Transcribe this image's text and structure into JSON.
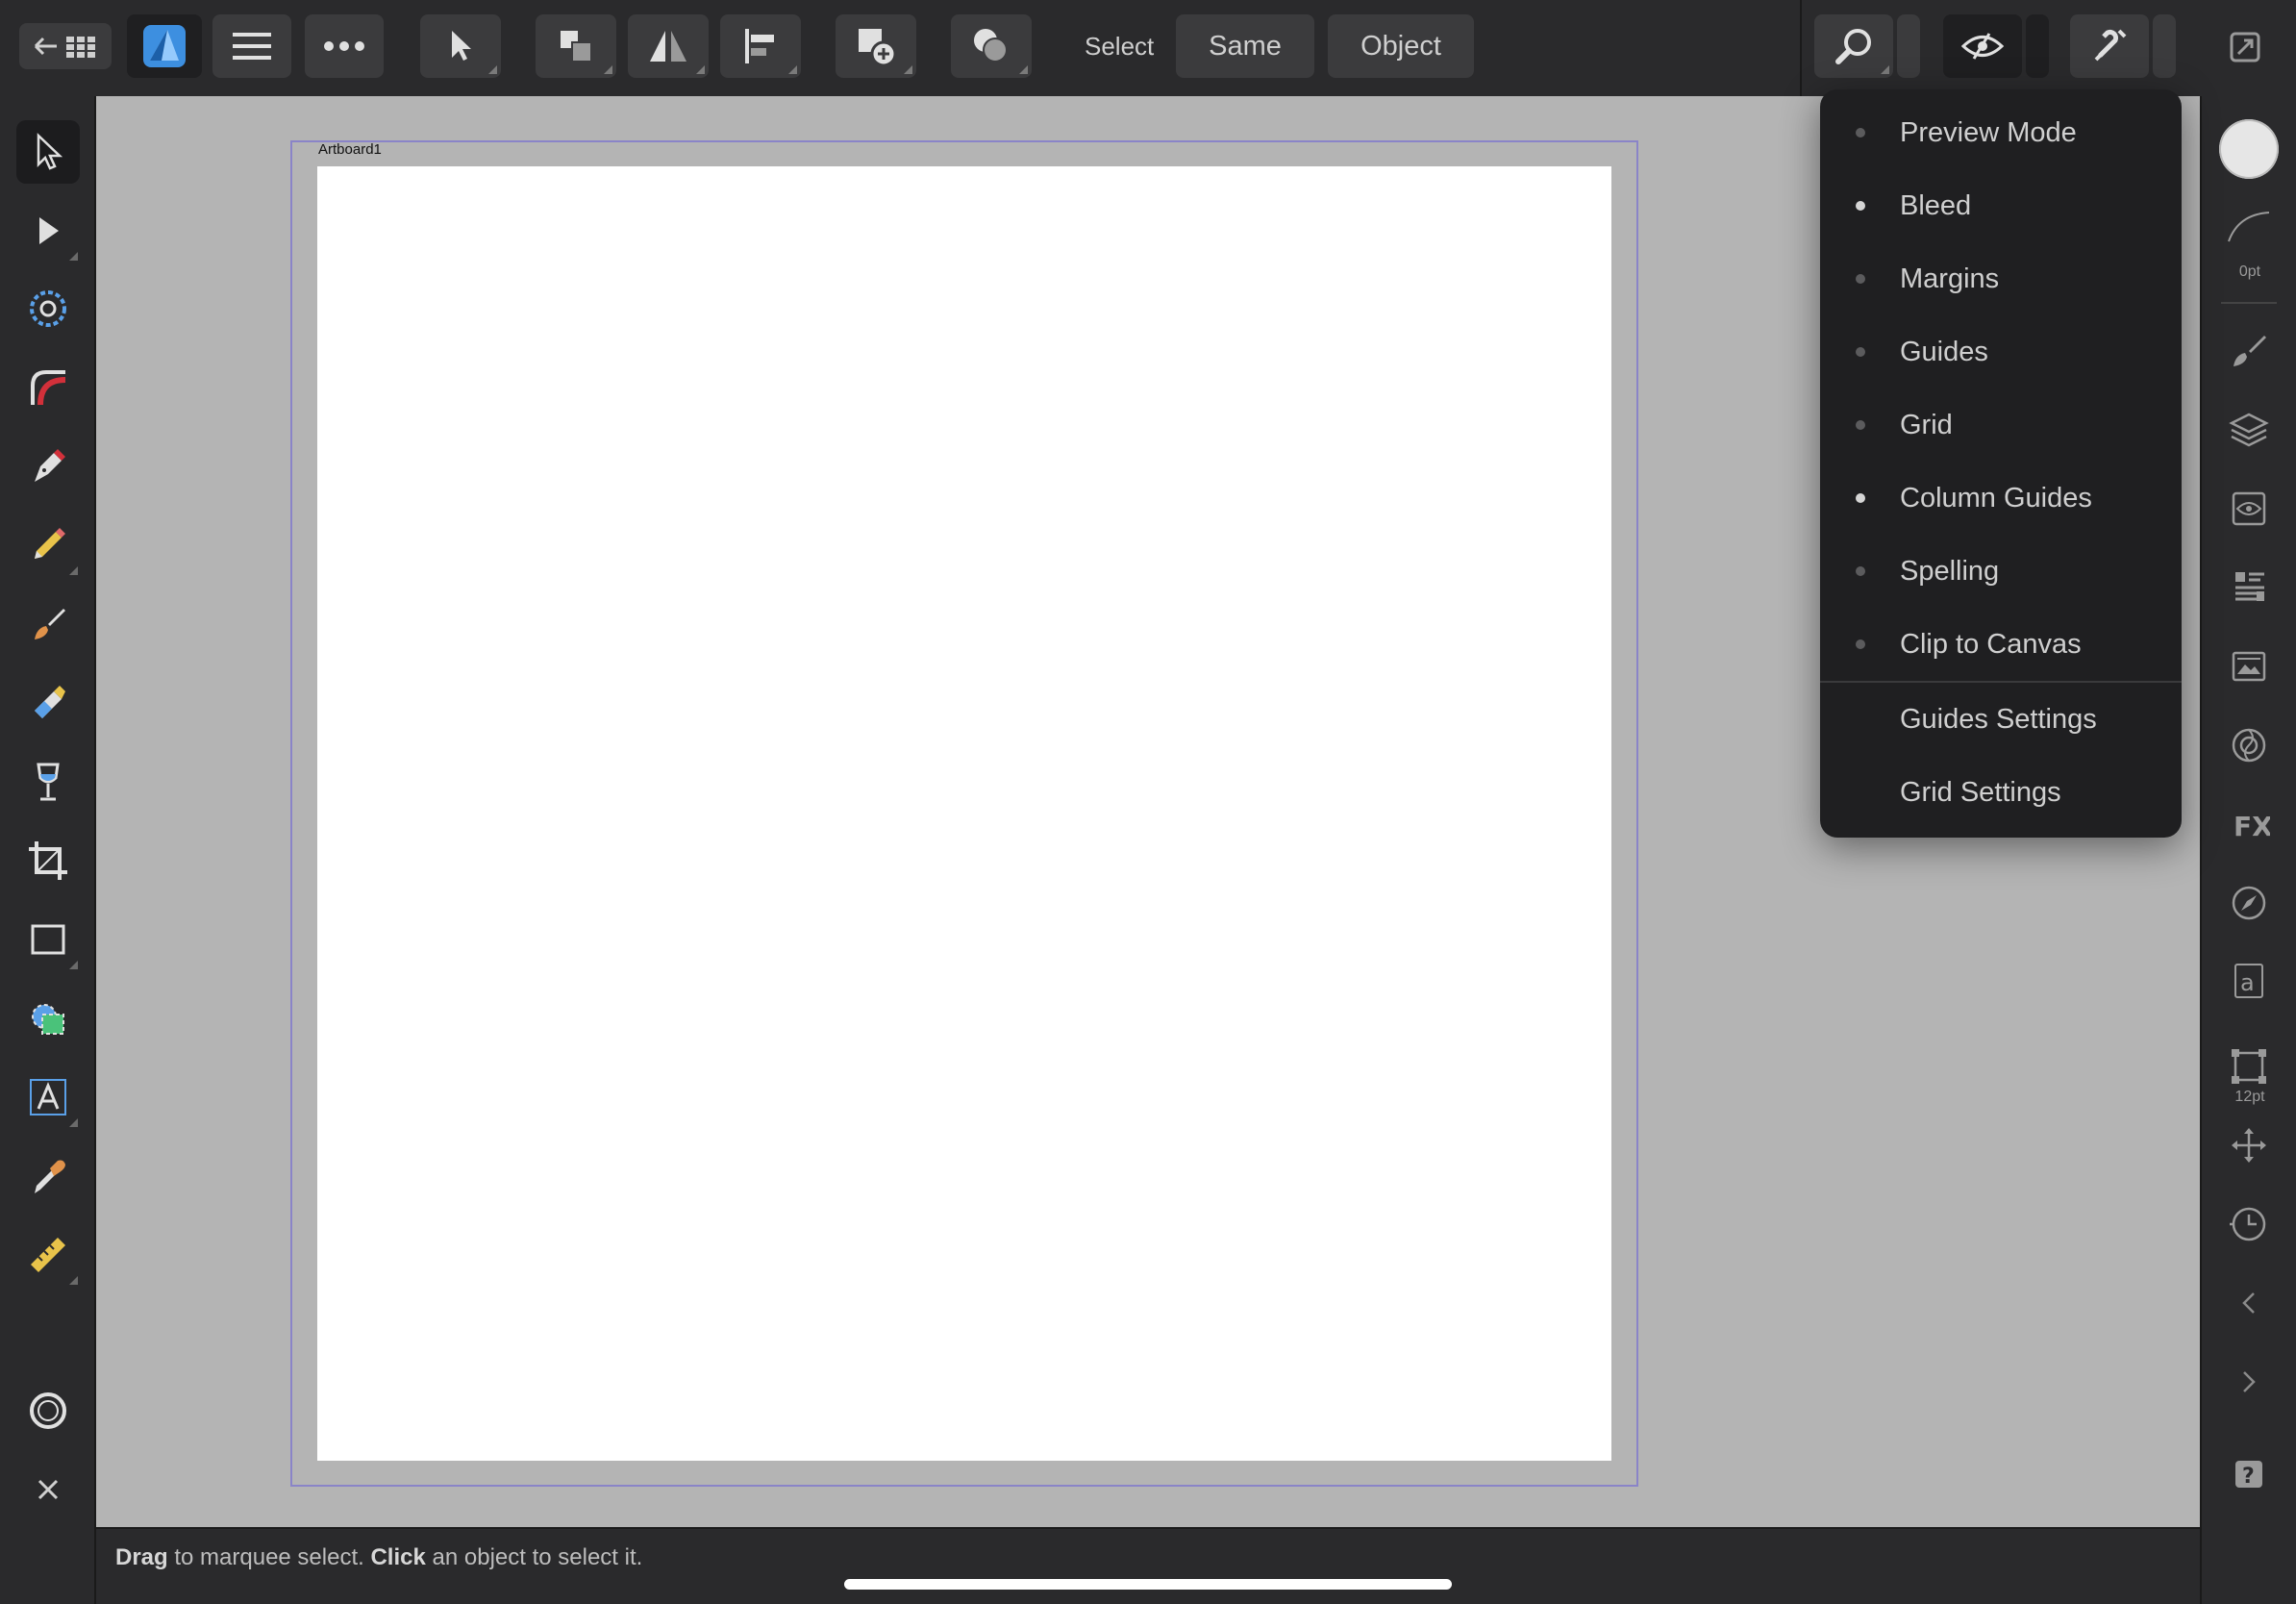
{
  "toolbar": {
    "select_label": "Select",
    "same_label": "Same",
    "object_label": "Object"
  },
  "canvas": {
    "artboard_label": "Artboard1"
  },
  "view_menu": {
    "toggles": [
      {
        "label": "Preview Mode",
        "on": false
      },
      {
        "label": "Bleed",
        "on": true
      },
      {
        "label": "Margins",
        "on": false
      },
      {
        "label": "Guides",
        "on": false
      },
      {
        "label": "Grid",
        "on": false
      },
      {
        "label": "Column Guides",
        "on": true
      },
      {
        "label": "Spelling",
        "on": false
      },
      {
        "label": "Clip to Canvas",
        "on": false
      }
    ],
    "settings": [
      {
        "label": "Guides Settings"
      },
      {
        "label": "Grid Settings"
      }
    ]
  },
  "right_panel": {
    "stroke_width": "0pt",
    "font_size": "12pt"
  },
  "status": {
    "drag": "Drag",
    "drag_rest": " to marquee select. ",
    "click": "Click",
    "click_rest": " an object to select it."
  },
  "colors": {
    "accent_blue": "#3d8fe0",
    "bg_dark": "#2a2a2c",
    "canvas_gray": "#b4b4b4",
    "artboard_border": "#8a84c8"
  }
}
